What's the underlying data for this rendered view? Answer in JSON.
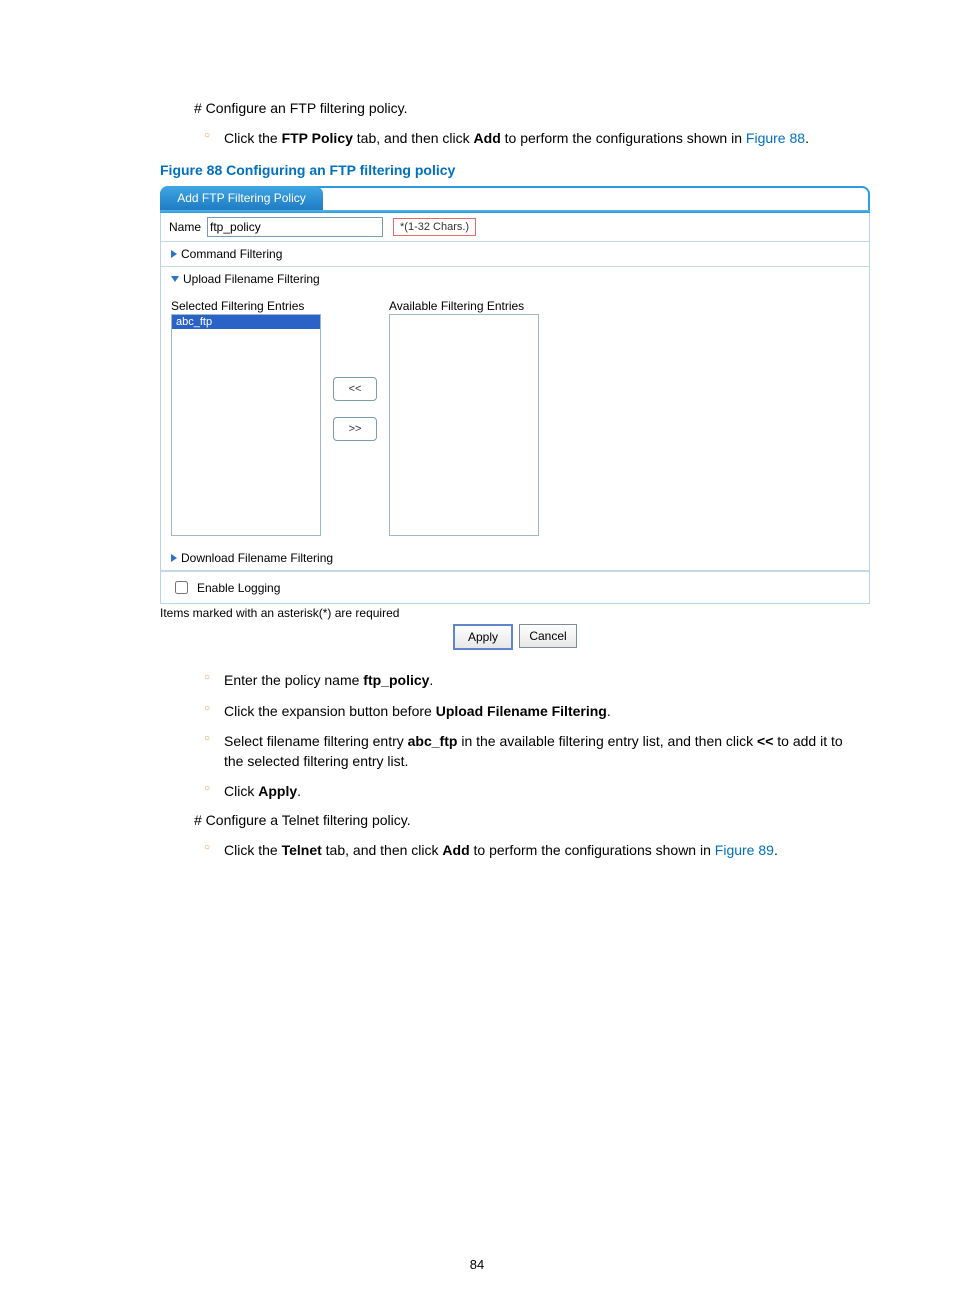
{
  "doc": {
    "step_configure_ftp": "# Configure an FTP filtering policy.",
    "step_click_ftp_pre": "Click the ",
    "step_click_ftp_tab": "FTP Policy",
    "step_click_ftp_mid": " tab, and then click ",
    "step_click_ftp_add": "Add",
    "step_click_ftp_post": " to perform the configurations shown in ",
    "step_click_ftp_xref": "Figure 88",
    "step_click_ftp_end": ".",
    "fig88_caption": "Figure 88 Configuring an FTP filtering policy",
    "step_enter_name_pre": "Enter the policy name ",
    "step_enter_name_val": "ftp_policy",
    "step_enter_name_end": ".",
    "step_expand_pre": "Click the expansion button before ",
    "step_expand_label": "Upload Filename Filtering",
    "step_expand_end": ".",
    "step_select_pre": "Select filename filtering entry ",
    "step_select_entry": "abc_ftp",
    "step_select_mid": " in the available filtering entry list, and then click ",
    "step_select_btn": "<<",
    "step_select_post": " to add it to the selected filtering entry list.",
    "step_apply_pre": "Click ",
    "step_apply_btn": "Apply",
    "step_apply_end": ".",
    "step_configure_telnet": "# Configure a Telnet filtering policy.",
    "step_click_telnet_pre": "Click the ",
    "step_click_telnet_tab": "Telnet",
    "step_click_telnet_mid": " tab, and then click ",
    "step_click_telnet_add": "Add",
    "step_click_telnet_post": " to perform the configurations shown in ",
    "step_click_telnet_xref": "Figure 89",
    "step_click_telnet_end": "."
  },
  "ui": {
    "tab_label": "Add FTP Filtering Policy",
    "name_label": "Name",
    "name_value": "ftp_policy",
    "name_hint": "*(1-32 Chars.)",
    "command_filtering_label": "Command Filtering",
    "upload_label": "Upload Filename Filtering",
    "selected_label": "Selected Filtering Entries",
    "available_label": "Available Filtering Entries",
    "selected_items": [
      "abc_ftp"
    ],
    "move_left_label": "<<",
    "move_right_label": ">>",
    "download_label": "Download Filename Filtering",
    "enable_logging_label": "Enable Logging",
    "required_note": "Items marked with an asterisk(*) are required",
    "apply_label": "Apply",
    "cancel_label": "Cancel"
  },
  "page_number": "84"
}
